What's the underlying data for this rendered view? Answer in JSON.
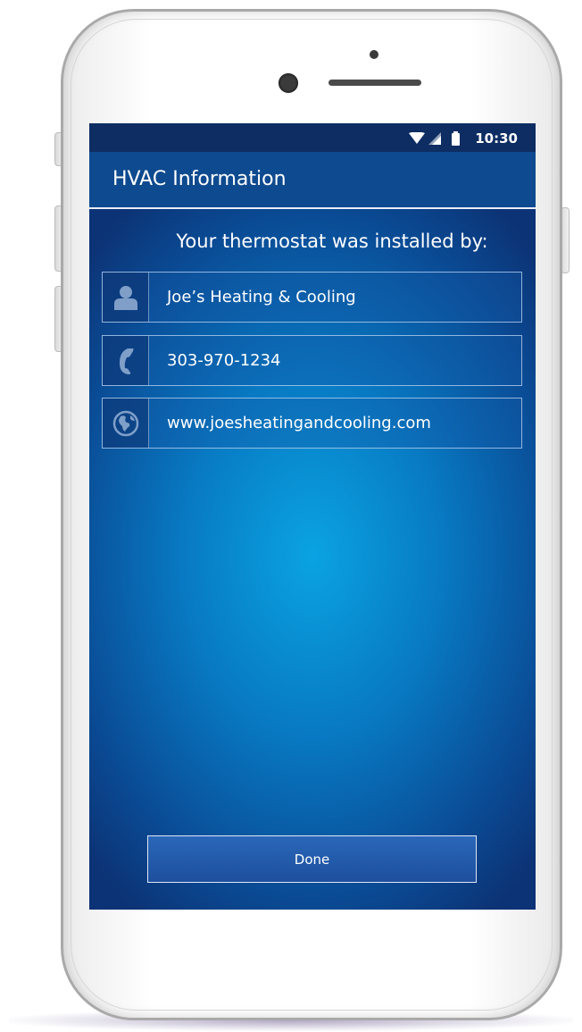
{
  "status_bar": {
    "time": "10:30"
  },
  "header": {
    "title": "HVAC Information"
  },
  "main": {
    "subtitle": "Your thermostat was installed by:",
    "contact": {
      "name": "Joe’s Heating & Cooling",
      "phone": "303-970-1234",
      "website": "www.joesheatingandcooling.com"
    }
  },
  "footer": {
    "done_label": "Done"
  },
  "icons": {
    "contact": "person-icon",
    "phone": "phone-icon",
    "website": "globe-icon",
    "status": [
      "wifi-icon",
      "signal-icon",
      "battery-icon"
    ]
  },
  "colors": {
    "accent": "#0e4a8f",
    "status_bar": "#0d2d63",
    "screen_center": "#0aa3e2"
  }
}
